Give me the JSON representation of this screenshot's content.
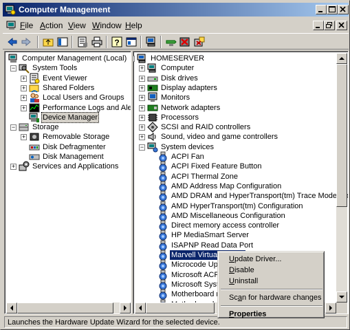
{
  "window": {
    "title": "Computer Management"
  },
  "menu": [
    {
      "label": "File",
      "key": "F",
      "rest": "ile"
    },
    {
      "label": "Action",
      "key": "A",
      "rest": "ction"
    },
    {
      "label": "View",
      "key": "V",
      "rest": "iew"
    },
    {
      "label": "Window",
      "key": "W",
      "rest": "indow"
    },
    {
      "label": "Help",
      "key": "H",
      "rest": "elp"
    }
  ],
  "toolbar_icons": [
    "back-icon",
    "forward-icon",
    "up-folder-icon",
    "show-hide-tree-icon",
    "properties-icon",
    "print-icon",
    "help-icon",
    "console-icon",
    "scan-hardware-icon",
    "update-driver-icon",
    "uninstall-icon",
    "disable-icon"
  ],
  "left_tree": [
    {
      "label": "Computer Management (Local)",
      "level": 0,
      "expander": "",
      "icon": "computer-management-icon"
    },
    {
      "label": "System Tools",
      "level": 1,
      "expander": "-",
      "icon": "system-tools-icon"
    },
    {
      "label": "Event Viewer",
      "level": 2,
      "expander": "+",
      "icon": "event-viewer-icon"
    },
    {
      "label": "Shared Folders",
      "level": 2,
      "expander": "+",
      "icon": "shared-folders-icon"
    },
    {
      "label": "Local Users and Groups",
      "level": 2,
      "expander": "+",
      "icon": "users-icon"
    },
    {
      "label": "Performance Logs and Alerts",
      "level": 2,
      "expander": "+",
      "icon": "performance-icon"
    },
    {
      "label": "Device Manager",
      "level": 2,
      "expander": "",
      "icon": "device-manager-icon",
      "selected": true
    },
    {
      "label": "Storage",
      "level": 1,
      "expander": "-",
      "icon": "storage-icon"
    },
    {
      "label": "Removable Storage",
      "level": 2,
      "expander": "+",
      "icon": "removable-storage-icon"
    },
    {
      "label": "Disk Defragmenter",
      "level": 2,
      "expander": "",
      "icon": "defrag-icon"
    },
    {
      "label": "Disk Management",
      "level": 2,
      "expander": "",
      "icon": "disk-management-icon"
    },
    {
      "label": "Services and Applications",
      "level": 1,
      "expander": "+",
      "icon": "services-icon"
    }
  ],
  "right_tree": [
    {
      "label": "HOMESERVER",
      "level": 0,
      "expander": "-",
      "icon": "server-icon"
    },
    {
      "label": "Computer",
      "level": 1,
      "expander": "+",
      "icon": "computer-icon"
    },
    {
      "label": "Disk drives",
      "level": 1,
      "expander": "+",
      "icon": "disk-drive-icon"
    },
    {
      "label": "Display adapters",
      "level": 1,
      "expander": "+",
      "icon": "display-adapter-icon"
    },
    {
      "label": "Monitors",
      "level": 1,
      "expander": "+",
      "icon": "monitor-icon"
    },
    {
      "label": "Network adapters",
      "level": 1,
      "expander": "+",
      "icon": "network-adapter-icon"
    },
    {
      "label": "Processors",
      "level": 1,
      "expander": "+",
      "icon": "processor-icon"
    },
    {
      "label": "SCSI and RAID controllers",
      "level": 1,
      "expander": "+",
      "icon": "scsi-icon"
    },
    {
      "label": "Sound, video and game controllers",
      "level": 1,
      "expander": "+",
      "icon": "sound-icon"
    },
    {
      "label": "System devices",
      "level": 1,
      "expander": "-",
      "icon": "system-devices-icon"
    },
    {
      "label": "ACPI Fan",
      "level": 2,
      "expander": "",
      "icon": "system-device-icon"
    },
    {
      "label": "ACPI Fixed Feature Button",
      "level": 2,
      "expander": "",
      "icon": "system-device-icon"
    },
    {
      "label": "ACPI Thermal Zone",
      "level": 2,
      "expander": "",
      "icon": "system-device-icon"
    },
    {
      "label": "AMD Address Map Configuration",
      "level": 2,
      "expander": "",
      "icon": "system-device-icon"
    },
    {
      "label": "AMD DRAM and HyperTransport(tm) Trace Mode Con",
      "level": 2,
      "expander": "",
      "icon": "system-device-icon"
    },
    {
      "label": "AMD HyperTransport(tm) Configuration",
      "level": 2,
      "expander": "",
      "icon": "system-device-icon"
    },
    {
      "label": "AMD Miscellaneous Configuration",
      "level": 2,
      "expander": "",
      "icon": "system-device-icon"
    },
    {
      "label": "Direct memory access controller",
      "level": 2,
      "expander": "",
      "icon": "system-device-icon"
    },
    {
      "label": "HP MediaSmart Server",
      "level": 2,
      "expander": "",
      "icon": "system-device-icon"
    },
    {
      "label": "ISAPNP Read Data Port",
      "level": 2,
      "expander": "",
      "icon": "system-device-icon"
    },
    {
      "label": "Marvell Virtual Device",
      "level": 2,
      "expander": "",
      "icon": "system-device-icon",
      "highlighted": true
    },
    {
      "label": "Microcode Update Device",
      "level": 2,
      "expander": "",
      "icon": "system-device-icon"
    },
    {
      "label": "Microsoft ACPI-Compliant System",
      "level": 2,
      "expander": "",
      "icon": "system-device-icon"
    },
    {
      "label": "Microsoft System Management BIOS Driver",
      "level": 2,
      "expander": "",
      "icon": "system-device-icon"
    },
    {
      "label": "Motherboard resources",
      "level": 2,
      "expander": "",
      "icon": "system-device-icon"
    },
    {
      "label": "Motherboard resources",
      "level": 2,
      "expander": "",
      "icon": "system-device-icon"
    }
  ],
  "context_menu": [
    {
      "label": "Update Driver...",
      "pre": "",
      "key": "U",
      "post": "pdate Driver..."
    },
    {
      "label": "Disable",
      "pre": "",
      "key": "D",
      "post": "isable"
    },
    {
      "label": "Uninstall",
      "pre": "",
      "key": "U",
      "post": "ninstall"
    },
    {
      "separator": true
    },
    {
      "label": "Scan for hardware changes",
      "pre": "Sc",
      "key": "a",
      "post": "n for hardware changes"
    },
    {
      "separator": true
    },
    {
      "label": "Properties",
      "pre": "",
      "key": "P",
      "post": "roperties",
      "bold": true
    }
  ],
  "status": {
    "text": "Launches the Hardware Update Wizard for the selected device."
  }
}
